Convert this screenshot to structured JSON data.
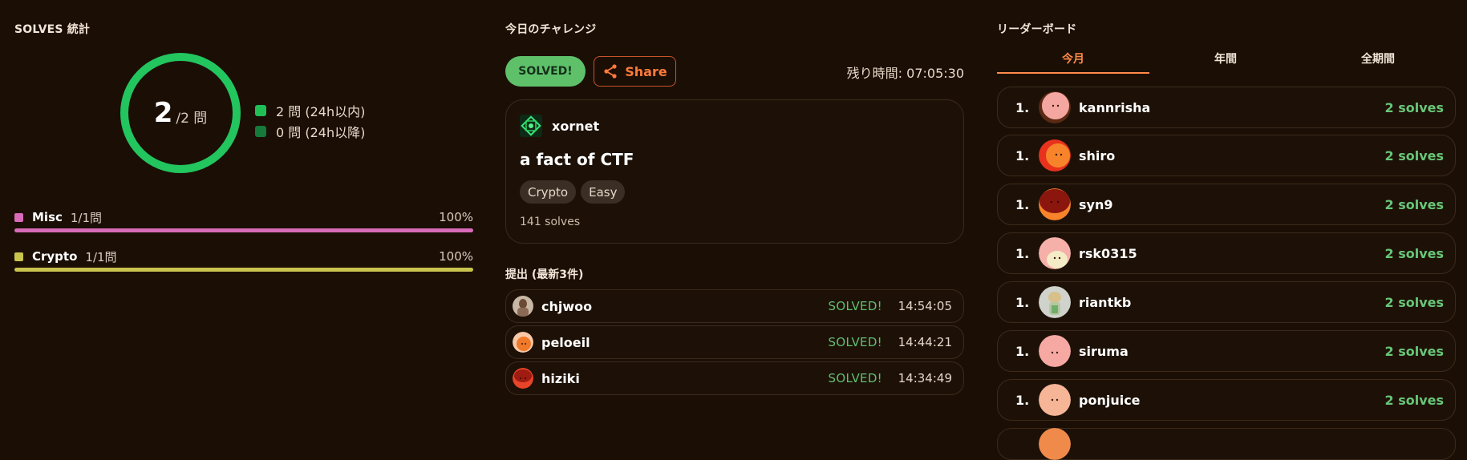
{
  "stats": {
    "title": "SOLVES 統計",
    "ring": {
      "solved": "2",
      "total_text": "/2 問",
      "fraction": 1.0
    },
    "legend": [
      {
        "text": "2 問 (24h以内)",
        "color": "#1fbf55"
      },
      {
        "text": "0 問 (24h以降)",
        "color": "#167a3a"
      }
    ],
    "categories": [
      {
        "name": "Misc",
        "count": "1/1問",
        "percent": "100%",
        "fraction": 1.0,
        "color": "#d86bb8"
      },
      {
        "name": "Crypto",
        "count": "1/1問",
        "percent": "100%",
        "fraction": 1.0,
        "color": "#c9c44d"
      }
    ]
  },
  "challenge": {
    "title": "今日のチャレンジ",
    "solved_badge": "SOLVED!",
    "share_label": "Share",
    "time_left": "残り時間: 07:05:30",
    "author": "xornet",
    "name": "a fact of CTF",
    "tags": [
      "Crypto",
      "Easy"
    ],
    "solves": "141 solves"
  },
  "submissions": {
    "title": "提出 (最新3件)",
    "items": [
      {
        "user": "chjwoo",
        "status": "SOLVED!",
        "time": "14:54:05",
        "avatar": "photo-brown"
      },
      {
        "user": "peloeil",
        "status": "SOLVED!",
        "time": "14:44:21",
        "avatar": "orange"
      },
      {
        "user": "hiziki",
        "status": "SOLVED!",
        "time": "14:34:49",
        "avatar": "red"
      }
    ]
  },
  "leaderboard": {
    "title": "リーダーボード",
    "tabs": [
      "今月",
      "年間",
      "全期間"
    ],
    "active_tab": 0,
    "rows": [
      {
        "rank": "1.",
        "user": "kannrisha",
        "solves": "2 solves",
        "avatar": "pink-brown"
      },
      {
        "rank": "1.",
        "user": "shiro",
        "solves": "2 solves",
        "avatar": "red-orange"
      },
      {
        "rank": "1.",
        "user": "syn9",
        "solves": "2 solves",
        "avatar": "darkred-orange"
      },
      {
        "rank": "1.",
        "user": "rsk0315",
        "solves": "2 solves",
        "avatar": "pink-cream"
      },
      {
        "rank": "1.",
        "user": "riantkb",
        "solves": "2 solves",
        "avatar": "photo-figure"
      },
      {
        "rank": "1.",
        "user": "siruma",
        "solves": "2 solves",
        "avatar": "pink"
      },
      {
        "rank": "1.",
        "user": "ponjuice",
        "solves": "2 solves",
        "avatar": "peach"
      }
    ]
  }
}
